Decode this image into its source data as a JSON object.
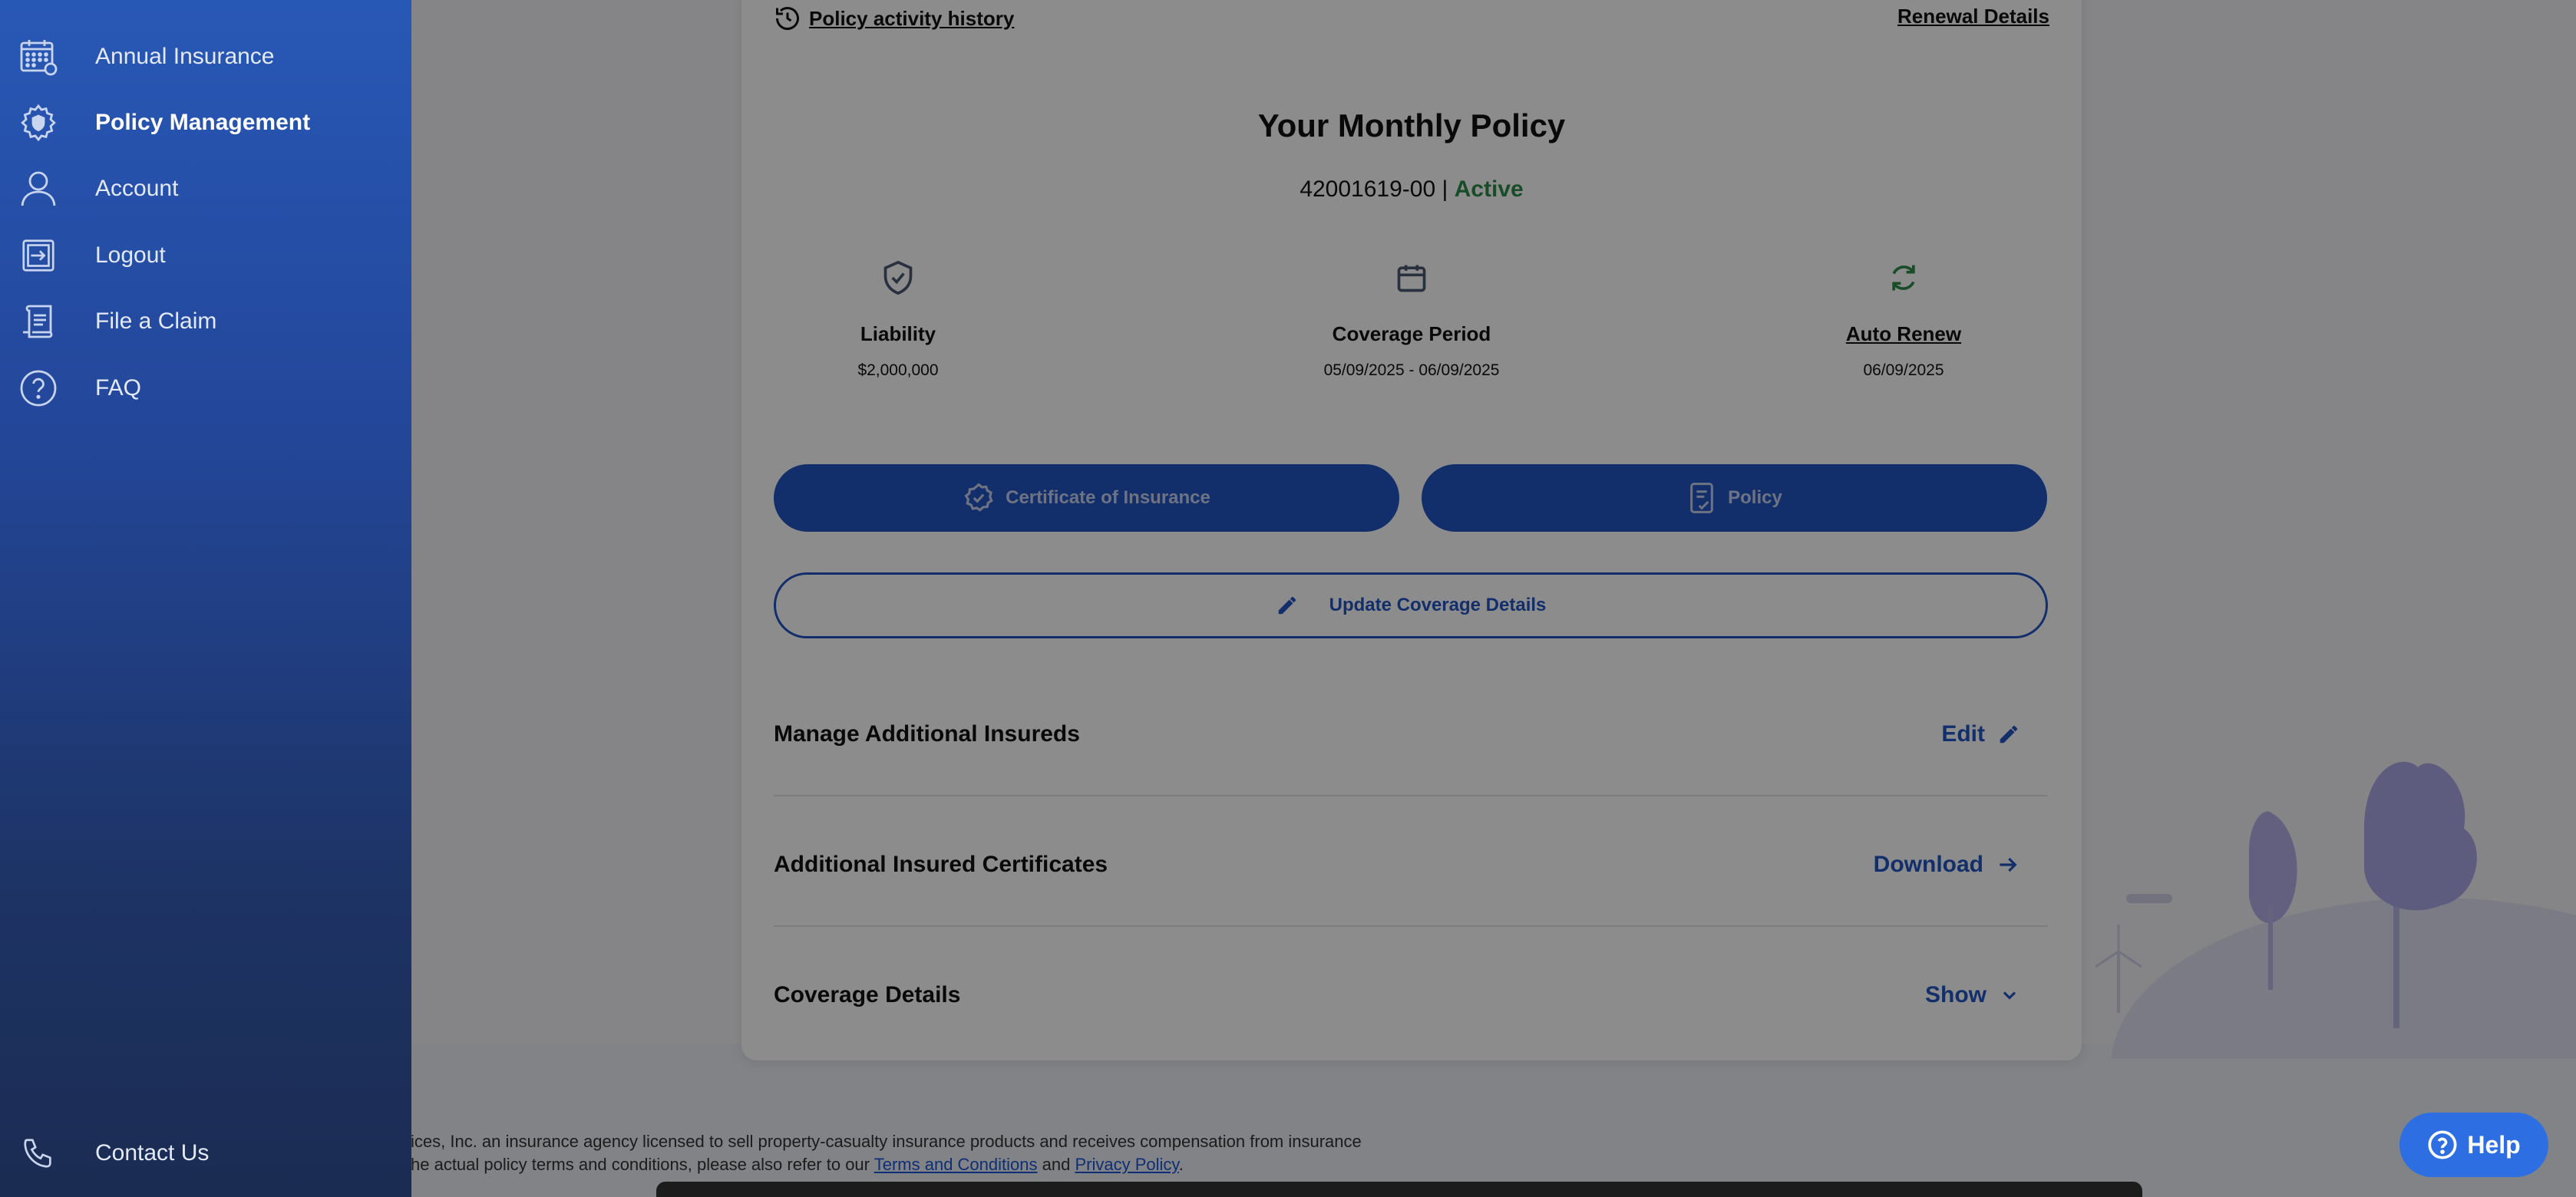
{
  "sidebar": {
    "items": [
      {
        "label": "Annual Insurance",
        "icon": "calendar-grid-icon",
        "active": false
      },
      {
        "label": "Policy Management",
        "icon": "gear-shield-icon",
        "active": true
      },
      {
        "label": "Account",
        "icon": "user-icon",
        "active": false
      },
      {
        "label": "Logout",
        "icon": "logout-icon",
        "active": false
      },
      {
        "label": "File a Claim",
        "icon": "claim-scroll-icon",
        "active": false
      },
      {
        "label": "FAQ",
        "icon": "question-icon",
        "active": false
      }
    ],
    "contact_label": "Contact Us"
  },
  "card": {
    "history_link": "Policy activity history",
    "renewal_link": "Renewal Details",
    "title": "Your Monthly Policy",
    "policy_number": "42001619-00",
    "separator": "|",
    "status": "Active",
    "stats": [
      {
        "label": "Liability",
        "value": "$2,000,000"
      },
      {
        "label": "Coverage Period",
        "value": "05/09/2025 - 06/09/2025"
      },
      {
        "label": "Auto Renew",
        "value": "06/09/2025"
      }
    ],
    "certificate_button": "Certificate of Insurance",
    "policy_button": "Policy",
    "update_button": "Update Coverage Details",
    "rows": [
      {
        "label": "Manage Additional Insureds",
        "action": "Edit"
      },
      {
        "label": "Additional Insured Certificates",
        "action": "Download"
      },
      {
        "label": "Coverage Details",
        "action": "Show"
      }
    ]
  },
  "footer": {
    "line1": "ices, Inc. an insurance agency licensed to sell property-casualty insurance products and receives compensation from insurance",
    "line2_prefix": "he actual policy terms and conditions, please also refer to our",
    "terms_link": "Terms and Conditions",
    "and": "and",
    "privacy_link": "Privacy Policy",
    "period": "."
  },
  "help_label": "Help",
  "colors": {
    "sidebar_top": "#2858b6",
    "sidebar_bottom": "#1b2c52",
    "primary": "#2356c4",
    "active_status": "#2f8a4c",
    "help": "#2d6fe3"
  }
}
